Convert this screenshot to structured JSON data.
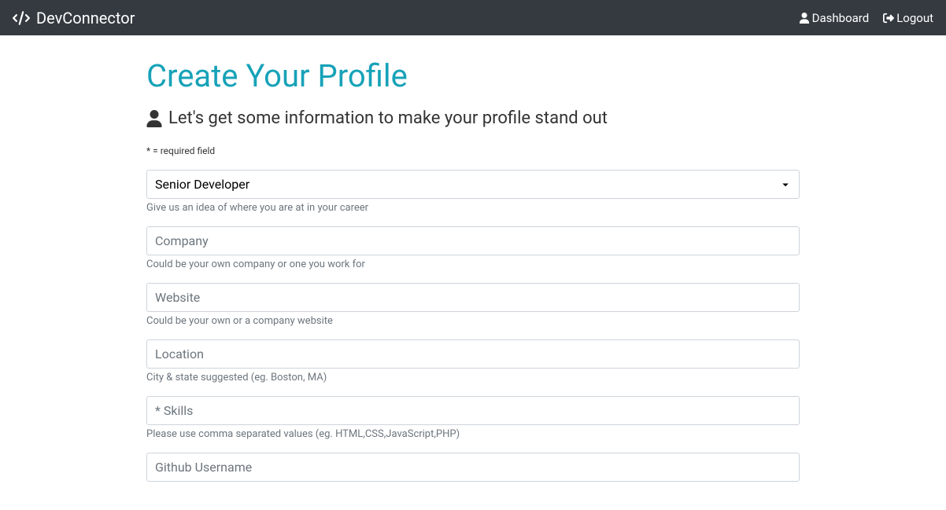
{
  "navbar": {
    "brand": "DevConnector",
    "dashboard": "Dashboard",
    "logout": "Logout"
  },
  "page": {
    "title": "Create Your Profile",
    "lead": "Let's get some information to make your profile stand out",
    "required_note": "* = required field"
  },
  "form": {
    "status": {
      "selected": "Senior Developer",
      "help": "Give us an idea of where you are at in your career"
    },
    "company": {
      "placeholder": "Company",
      "help": "Could be your own company or one you work for"
    },
    "website": {
      "placeholder": "Website",
      "help": "Could be your own or a company website"
    },
    "location": {
      "placeholder": "Location",
      "help": "City & state suggested (eg. Boston, MA)"
    },
    "skills": {
      "placeholder": "* Skills",
      "help": "Please use comma separated values (eg. HTML,CSS,JavaScript,PHP)"
    },
    "github": {
      "placeholder": "Github Username"
    }
  }
}
